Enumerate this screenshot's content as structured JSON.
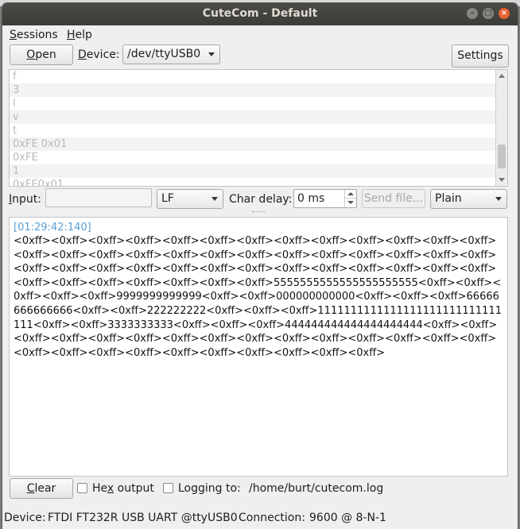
{
  "window": {
    "title": "CuteCom - Default",
    "controls": {
      "close": "×",
      "maximize": "□",
      "minimize": "–"
    }
  },
  "menubar": {
    "sessions": {
      "mnemonic": "S",
      "rest": "essions"
    },
    "help": {
      "mnemonic": "H",
      "rest": "elp"
    }
  },
  "toolbar": {
    "open_label": {
      "mnemonic": "O",
      "rest": "pen"
    },
    "device_label": {
      "mnemonic": "D",
      "rest": "evice:"
    },
    "device_value": "/dev/ttyUSB0",
    "settings_label": "Settings"
  },
  "history": {
    "items": [
      "f",
      "3",
      "l",
      "v",
      "t",
      "0xFE 0x01",
      "0xFE",
      "1",
      "0xFE0x01"
    ]
  },
  "input_row": {
    "input_label": {
      "mnemonic": "I",
      "rest": "nput:"
    },
    "input_value": "",
    "line_ending": "LF",
    "char_delay_label": "Char delay:",
    "char_delay_value": "0 ms",
    "send_file_label": "Send file...",
    "mode": "Plain"
  },
  "output": {
    "timestamp": "[01:29:42:140]",
    "text": "<0xff><0xff><0xff><0xff><0xff><0xff><0xff><0xff><0xff><0xff><0xff><0xff><0xff><0xff><0xff><0xff><0xff><0xff><0xff><0xff><0xff><0xff><0xff><0xff><0xff><0xff><0xff><0xff><0xff><0xff><0xff><0xff><0xff><0xff><0xff><0xff><0xff><0xff><0xff><0xff><0xff><0xff><0xff><0xff><0xff><0xff>5555555555555555555555<0xff><0xff><0xff><0xff><0xff>9999999999999<0xff><0xff>000000000000<0xff><0xff><0xff>66666666666666<0xff><0xff>222222222<0xff><0xff><0xff>1111111111111111111111111111111<0xff><0xff>3333333333<0xff><0xff><0xff>444444444444444444444<0xff><0xff><0xff><0xff><0xff><0xff><0xff><0xff><0xff><0xff><0xff><0xff><0xff><0xff><0xff><0xff><0xff><0xff><0xff><0xff><0xff><0xff><0xff><0xff><0xff>"
  },
  "bottom": {
    "clear_label": {
      "mnemonic": "C",
      "rest": "lear"
    },
    "hex_output": {
      "pre": "He",
      "mnemonic": "x",
      "rest": " output"
    },
    "logging_label": "Logging to:",
    "log_path": "/home/burt/cutecom.log"
  },
  "status": {
    "device_label": "Device:",
    "device_value": "FTDI FT232R USB UART @ttyUSB0",
    "connection_label": "Connection:",
    "connection_value": "9600 @ 8-N-1"
  }
}
